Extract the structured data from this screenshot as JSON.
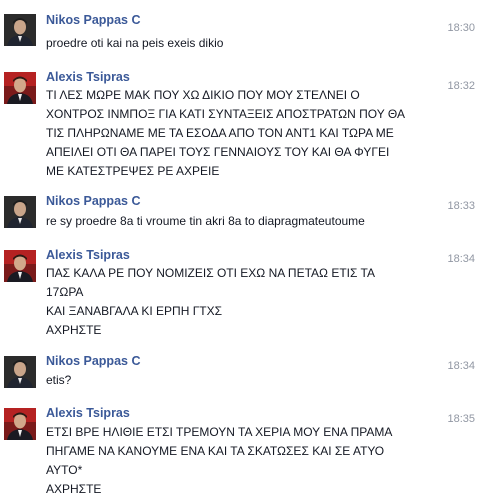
{
  "messages": [
    {
      "sender": "Nikos Pappas C",
      "avatar_icon": "nikos-avatar-icon",
      "time": "18:30",
      "text": "proedre oti kai na peis exeis dikio"
    },
    {
      "sender": "Alexis Tsipras",
      "avatar_icon": "alexis-avatar-icon",
      "time": "18:32",
      "text": "ΤΙ ΛΕΣ ΜΩΡΕ ΜΑΚ ΠΟΥ ΧΩ ΔΙΚΙΟ ΠΟΥ ΜΟΥ ΣΤΕΛΝΕΙ Ο\nΧΟΝΤΡΟΣ ΙΝΜΠΟΞ ΓΙΑ ΚΑΤΙ ΣΥΝΤΑΞΕΙΣ ΑΠΟΣΤΡΑΤΩΝ ΠΟΥ ΘΑ\nΤΙΣ ΠΛΗΡΩΝΑΜΕ ΜΕ ΤΑ ΕΣΟΔΑ ΑΠΟ ΤΟΝ ΑΝΤ1 ΚΑΙ ΤΩΡΑ ΜΕ\nΑΠΕΙΛΕΙ ΟΤΙ ΘΑ ΠΑΡΕΙ ΤΟΥΣ ΓΕΝΝΑΙΟΥΣ ΤΟΥ ΚΑΙ ΘΑ ΦΥΓΕΙ\nΜΕ ΚΑΤΕΣΤΡΕΨΕΣ ΡΕ ΑΧΡΕΙΕ"
    },
    {
      "sender": "Nikos Pappas C",
      "avatar_icon": "nikos-avatar-icon",
      "time": "18:33",
      "text": "re sy proedre 8a ti vroume tin akri 8a to diapragmateutoume"
    },
    {
      "sender": "Alexis Tsipras",
      "avatar_icon": "alexis-avatar-icon",
      "time": "18:34",
      "text": "ΠΑΣ ΚΑΛΑ ΡΕ ΠΟΥ ΝΟΜΙΖΕΙΣ ΟΤΙ ΕΧΩ ΝΑ ΠΕΤΑΩ ΕΤΙΣ ΤΑ\n17ΩΡΑ\nΚΑΙ ΞΑΝΑΒΓΑΛΑ ΚΙ ΕΡΠΗ ΓΤΧΣ\nΑΧΡΗΣΤΕ"
    },
    {
      "sender": "Nikos Pappas C",
      "avatar_icon": "nikos-avatar-icon",
      "time": "18:34",
      "text": "etis?"
    },
    {
      "sender": "Alexis Tsipras",
      "avatar_icon": "alexis-avatar-icon",
      "time": "18:35",
      "text": "ΕΤΣΙ ΒΡΕ ΗΛΙΘΙΕ ΕΤΣΙ ΤΡΕΜΟΥΝ ΤΑ ΧΕΡΙΑ ΜΟΥ ΕΝΑ ΠΡΑΜΑ\nΠΗΓΑΜΕ ΝΑ ΚΑΝΟΥΜΕ ΕΝΑ ΚΑΙ ΤΑ ΣΚΑΤΩΣΕΣ ΚΑΙ ΣΕ ΑΤΥΟ\nΑΥΤΟ*\nΑΧΡΗΣΤΕ"
    }
  ]
}
